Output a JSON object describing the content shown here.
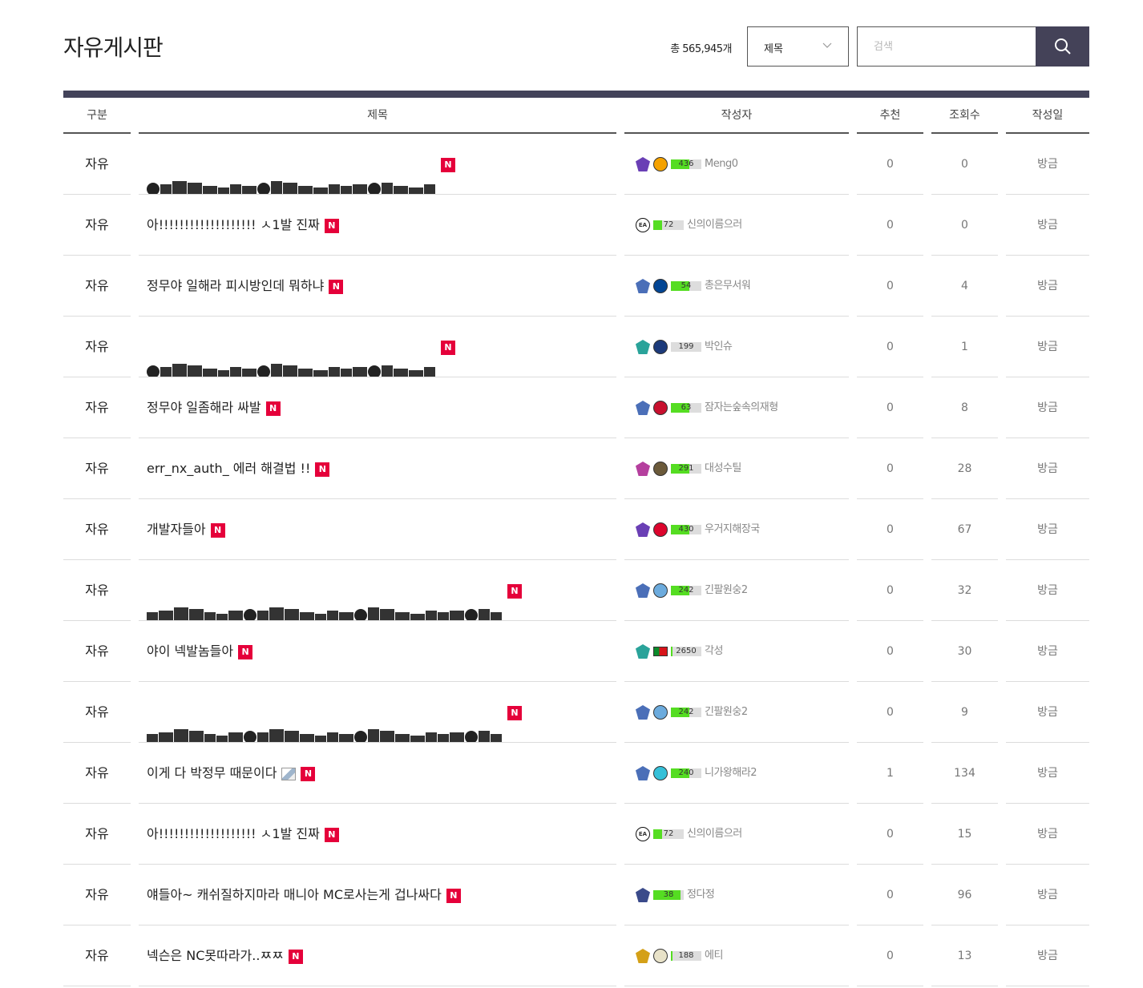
{
  "header": {
    "title": "자유게시판",
    "total": "총 565,945개",
    "select_value": "제목",
    "search_placeholder": "검색"
  },
  "columns": {
    "category": "구분",
    "title": "제목",
    "author": "작성자",
    "recommend": "추천",
    "views": "조회수",
    "date": "작성일"
  },
  "colors": {
    "accent": "#43435a",
    "new_badge": "#e5003a",
    "level_bar": "#55dd22"
  },
  "new_badge_label": "N",
  "rows": [
    {
      "category": "자유",
      "title": "",
      "redacted": true,
      "author": "Meng0",
      "level": "436",
      "level_fill": 0.6,
      "rank_icon": "rank-purple-icon",
      "club_icon": "wolves-crest-icon",
      "recommend": "0",
      "views": "0",
      "date": "방금"
    },
    {
      "category": "자유",
      "title": "아!!!!!!!!!!!!!!!!!!!  ㅅ1발 진짜",
      "author": "신의이름으러",
      "level": "72",
      "level_fill": 0.3,
      "rank_icon": "ea-logo-icon",
      "club_icon": "",
      "recommend": "0",
      "views": "0",
      "date": "방금"
    },
    {
      "category": "자유",
      "title": "정무야 일해라 피시방인데 뭐하냐",
      "author": "총은무서워",
      "level": "54",
      "level_fill": 0.6,
      "rank_icon": "rank-blue-icon",
      "club_icon": "chelsea-crest-icon",
      "recommend": "0",
      "views": "4",
      "date": "방금"
    },
    {
      "category": "자유",
      "title": "",
      "redacted": true,
      "author": "박인슈",
      "level": "199",
      "level_fill": 0.0,
      "rank_icon": "rank-teal-icon",
      "club_icon": "psg-crest-icon",
      "recommend": "0",
      "views": "1",
      "date": "방금"
    },
    {
      "category": "자유",
      "title": "정무야 일좀해라 싸발",
      "author": "잠자는숲속의재형",
      "level": "63",
      "level_fill": 0.6,
      "rank_icon": "rank-blue-icon",
      "club_icon": "milan-crest-icon",
      "recommend": "0",
      "views": "8",
      "date": "방금"
    },
    {
      "category": "자유",
      "title": "err_nx_auth_ 에러 해결법 !!",
      "author": "대성수틸",
      "level": "291",
      "level_fill": 0.6,
      "rank_icon": "rank-pink-icon",
      "club_icon": "galatasaray-crest-icon",
      "recommend": "0",
      "views": "28",
      "date": "방금"
    },
    {
      "category": "자유",
      "title": "개발자들아",
      "author": "우거지해장국",
      "level": "430",
      "level_fill": 0.6,
      "rank_icon": "rank-purple-icon",
      "club_icon": "bayern-crest-icon",
      "recommend": "0",
      "views": "67",
      "date": "방금"
    },
    {
      "category": "자유",
      "title": "",
      "redacted": true,
      "redacted_long": true,
      "author": "긴팔원숭2",
      "level": "242",
      "level_fill": 0.6,
      "rank_icon": "rank-blue-icon",
      "club_icon": "mancity-crest-icon",
      "recommend": "0",
      "views": "32",
      "date": "방금"
    },
    {
      "category": "자유",
      "title": "야이 넥발놈들아",
      "author": "각성",
      "level": "2650",
      "level_fill": 0.05,
      "rank_icon": "rank-teal-icon",
      "club_icon": "portugal-flag-icon",
      "recommend": "0",
      "views": "30",
      "date": "방금"
    },
    {
      "category": "자유",
      "title": "",
      "redacted": true,
      "redacted_long": true,
      "author": "긴팔원숭2",
      "level": "242",
      "level_fill": 0.6,
      "rank_icon": "rank-blue-icon",
      "club_icon": "mancity-crest-icon",
      "recommend": "0",
      "views": "9",
      "date": "방금"
    },
    {
      "category": "자유",
      "title": "이게 다 박정무 때문이다",
      "has_image": true,
      "author": "니가왕해라2",
      "level": "240",
      "level_fill": 0.6,
      "rank_icon": "rank-blue-icon",
      "club_icon": "bird-crest-icon",
      "recommend": "1",
      "views": "134",
      "date": "방금"
    },
    {
      "category": "자유",
      "title": "아!!!!!!!!!!!!!!!!!!!  ㅅ1발 진짜",
      "author": "신의이름으러",
      "level": "72",
      "level_fill": 0.3,
      "rank_icon": "ea-logo-icon",
      "club_icon": "",
      "recommend": "0",
      "views": "15",
      "date": "방금"
    },
    {
      "category": "자유",
      "title": "얘들아~ 캐쉬질하지마라 매니아 MC로사는게 겁나싸다",
      "author": "정다정",
      "level": "38",
      "level_fill": 0.9,
      "rank_icon": "rank-navy-icon",
      "club_icon": "",
      "recommend": "0",
      "views": "96",
      "date": "방금"
    },
    {
      "category": "자유",
      "title": "넥슨은 NC못따라가..ㅉㅉ",
      "author": "에티",
      "level": "188",
      "level_fill": 0.05,
      "rank_icon": "rank-gold-icon",
      "club_icon": "realmadrid-crest-icon",
      "recommend": "0",
      "views": "13",
      "date": "방금"
    }
  ]
}
